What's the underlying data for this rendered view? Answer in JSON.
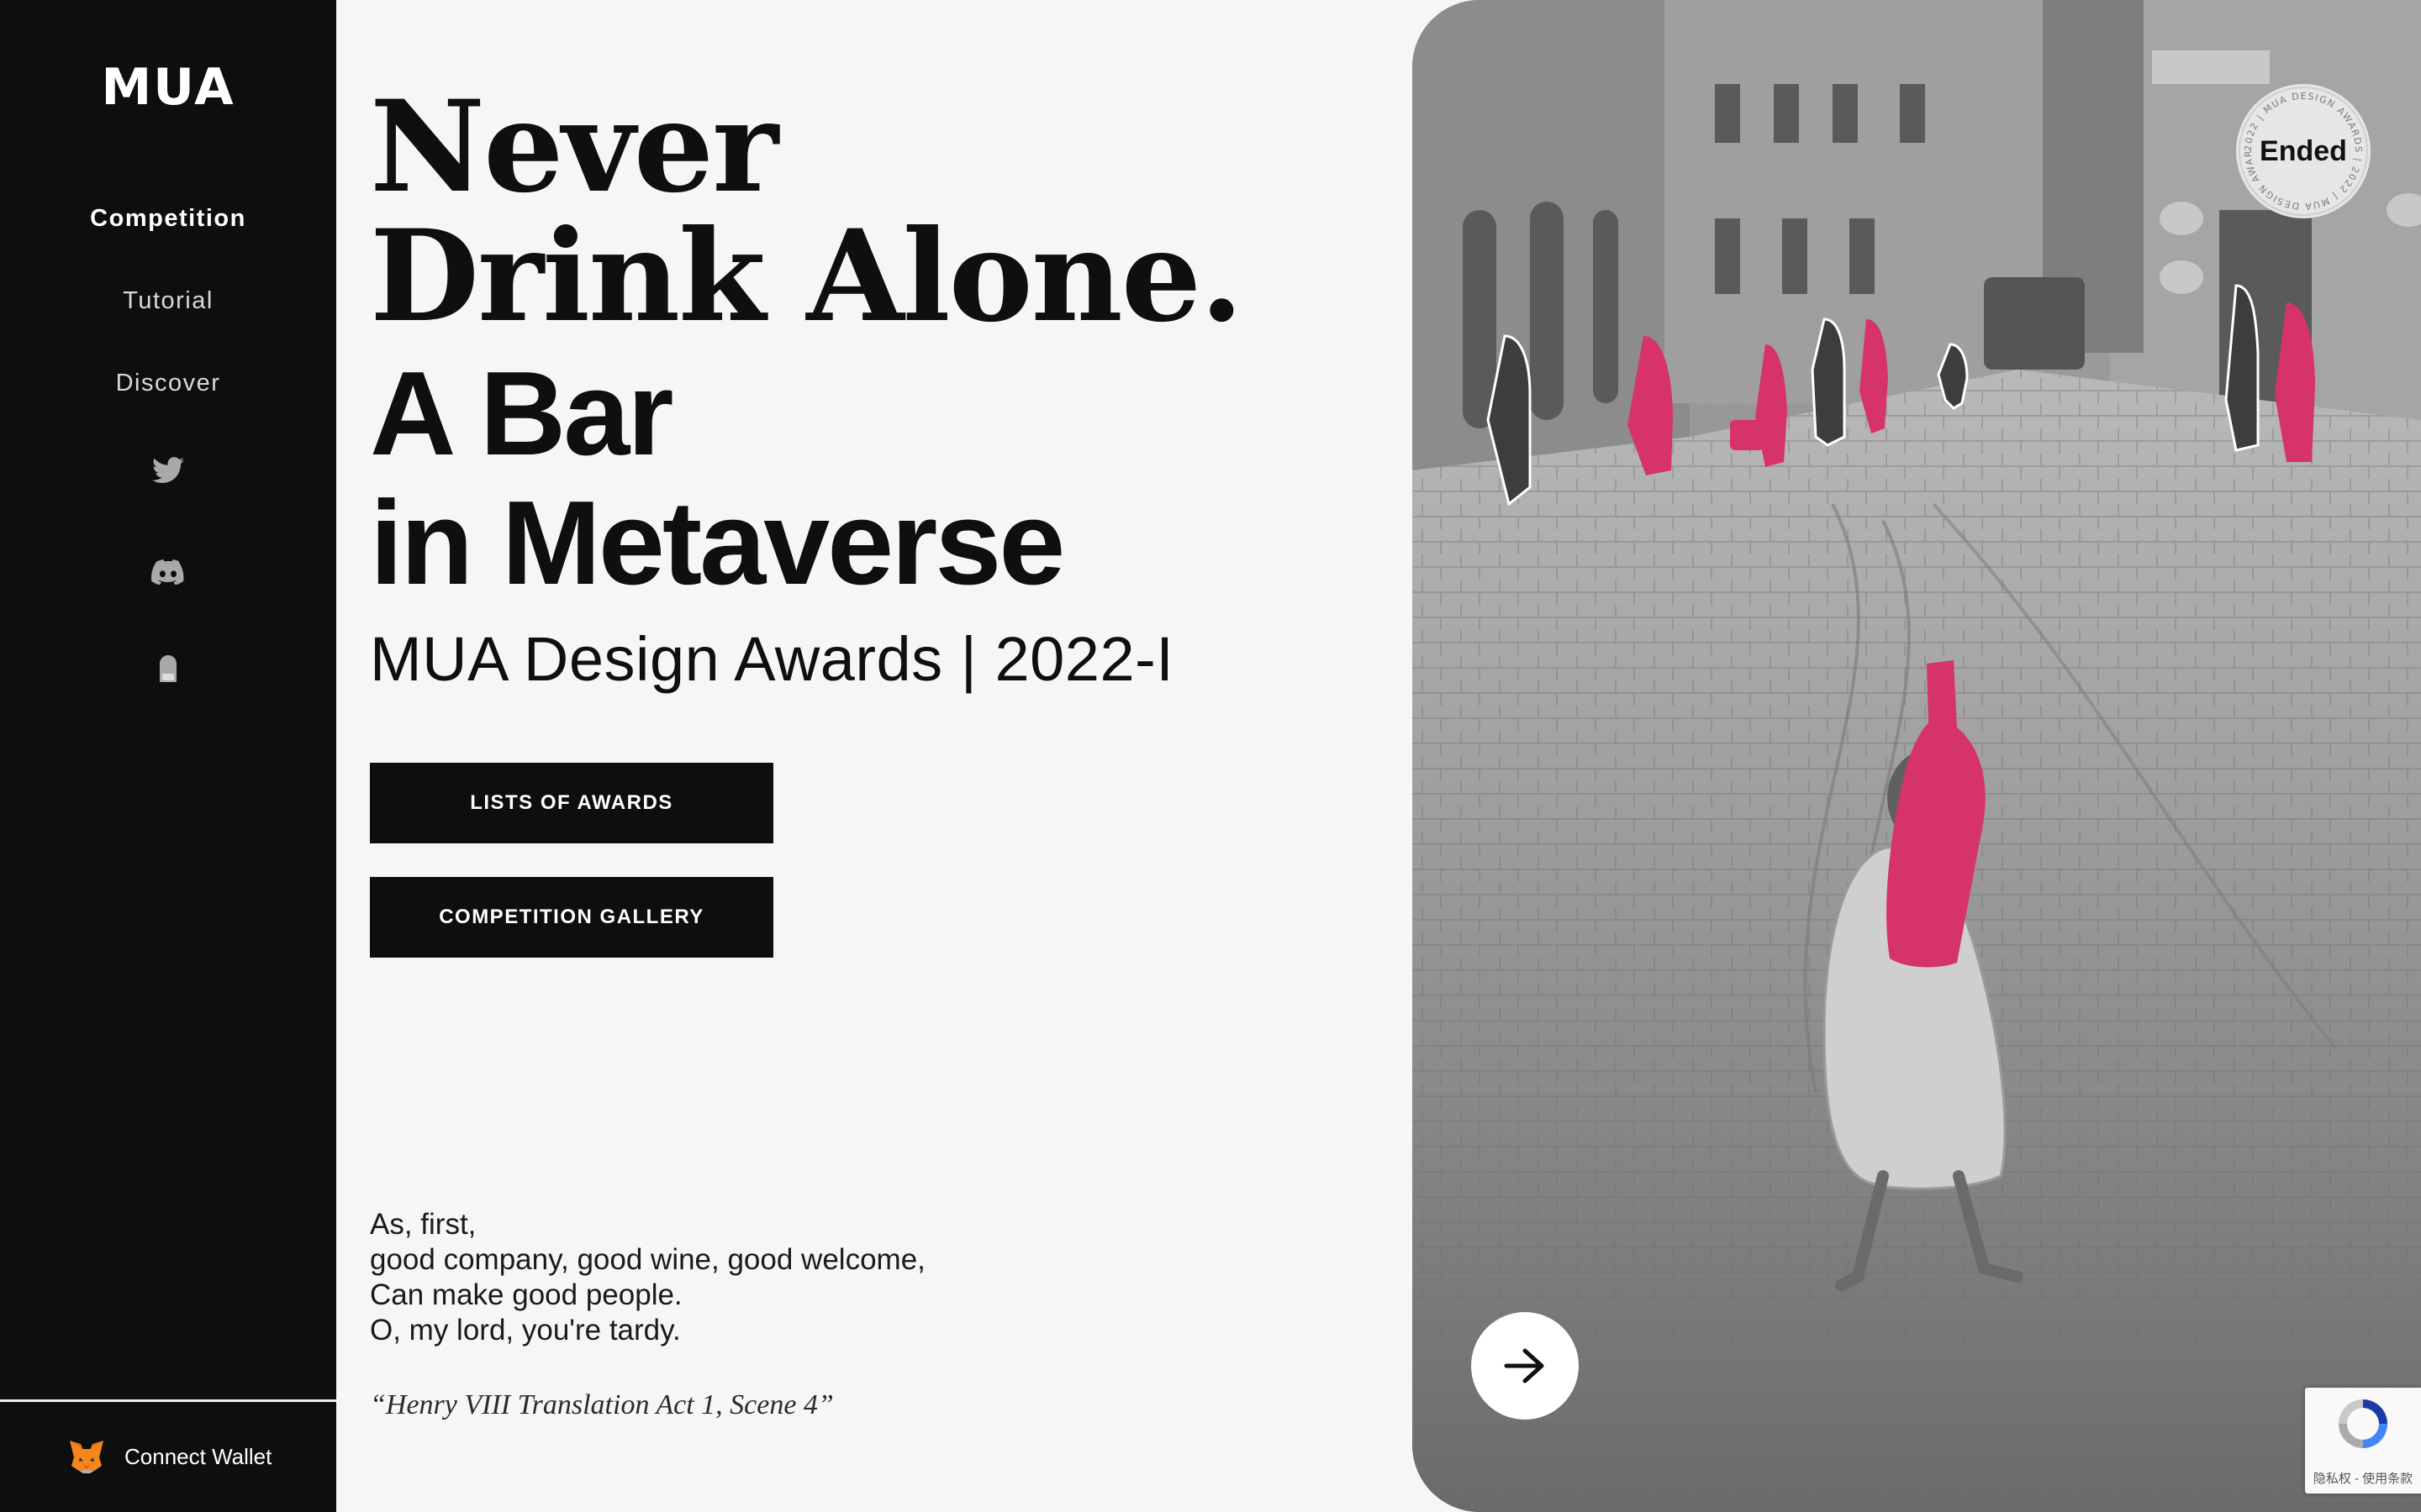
{
  "brand": {
    "logo_text": "MUA"
  },
  "nav": {
    "items": [
      {
        "label": "Competition",
        "active": true
      },
      {
        "label": "Tutorial",
        "active": false
      },
      {
        "label": "Discover",
        "active": false
      }
    ],
    "social_icons": [
      "twitter-icon",
      "discord-icon",
      "door-icon"
    ]
  },
  "wallet": {
    "label": "Connect Wallet",
    "icon": "metamask-fox-icon"
  },
  "hero": {
    "line1": "Never",
    "line2": "Drink Alone.",
    "line3": "A Bar",
    "line4": "in Metaverse",
    "subtitle": "MUA Design Awards | 2022-I"
  },
  "buttons": {
    "awards_label": "LISTS OF AWARDS",
    "gallery_label": "COMPETITION GALLERY"
  },
  "poem": {
    "lines": [
      "As, first,",
      "good company, good wine, good welcome,",
      "Can make good people.",
      "O, my lord, you're tardy."
    ],
    "citation": "“Henry VIII Translation Act 1, Scene 4”"
  },
  "badge": {
    "label": "Ended",
    "ring_text": "2022 | MUA DESIGN AWARDS | 2022 | MUA DESIGN AWARDS"
  },
  "recaptcha": {
    "label": "隐私权 - 使用条款"
  },
  "colors": {
    "accent": "#d6336c",
    "dark": "#0d0e10",
    "background": "#f5f6f5"
  }
}
